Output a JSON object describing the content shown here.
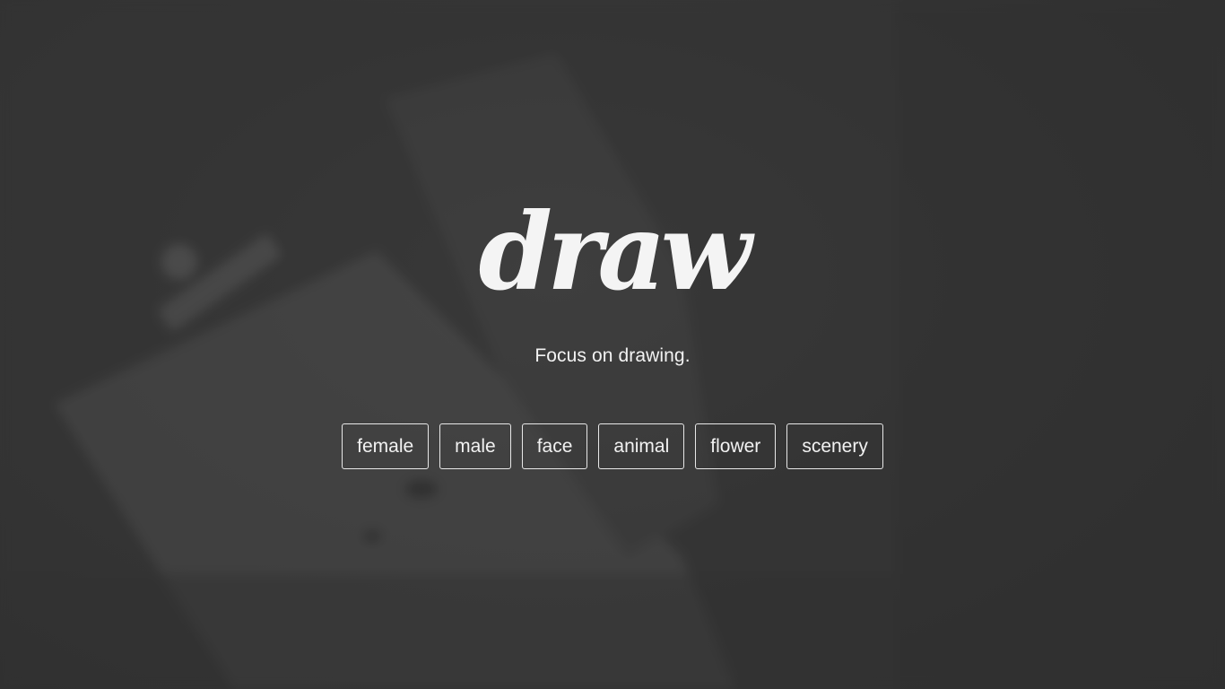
{
  "brand": {
    "logo_text": "draw",
    "tagline": "Focus on drawing."
  },
  "categories": [
    {
      "label": "female"
    },
    {
      "label": "male"
    },
    {
      "label": "face"
    },
    {
      "label": "animal"
    },
    {
      "label": "flower"
    },
    {
      "label": "scenery"
    }
  ],
  "colors": {
    "background": "#333333",
    "text": "#f2f2f2",
    "button_border": "#e8e8e8"
  }
}
